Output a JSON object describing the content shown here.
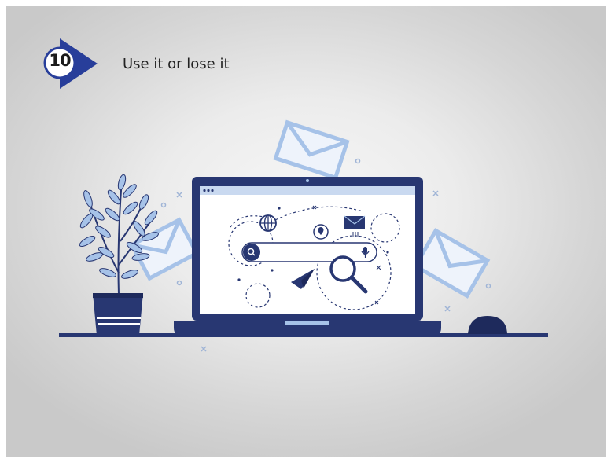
{
  "step": {
    "number": "10"
  },
  "title": "Use it or lose it",
  "colors": {
    "navy": "#283772",
    "navy_dark": "#1e2a5c",
    "light_blue": "#a6c2e8",
    "pale_blue": "#c9d9f0",
    "screen_bg": "#ffffff"
  },
  "icons": [
    "envelope-icon",
    "globe-icon",
    "search-icon",
    "magnifier-icon",
    "microphone-icon",
    "paper-plane-icon",
    "location-pin-icon",
    "plant-icon",
    "mouse-icon"
  ]
}
